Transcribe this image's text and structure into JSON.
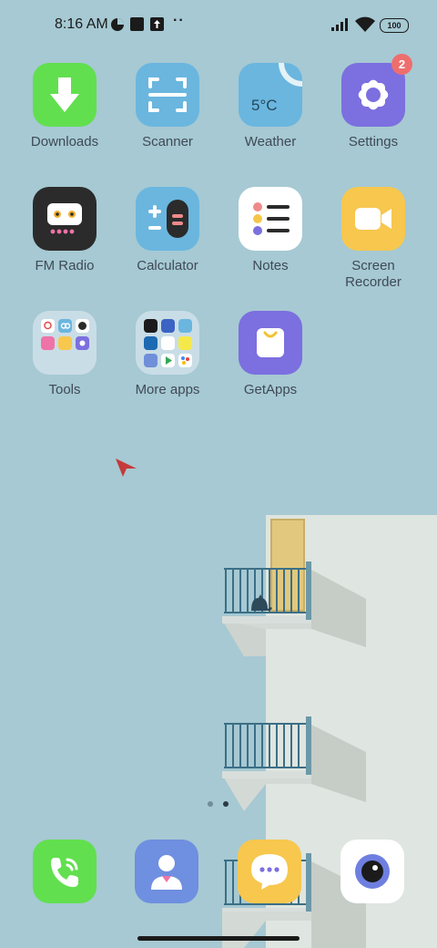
{
  "status_bar": {
    "time": "8:16 AM",
    "battery_text": "100",
    "more_indicator": "··",
    "icons": [
      "data-saver-icon",
      "square-notification-icon",
      "upload-notification-icon",
      "signal-icon",
      "wifi-icon",
      "battery-icon"
    ]
  },
  "apps": [
    {
      "label": "Downloads"
    },
    {
      "label": "Scanner"
    },
    {
      "label": "Weather",
      "temperature": "5°C"
    },
    {
      "label": "Settings",
      "badge": "2"
    },
    {
      "label": "FM Radio"
    },
    {
      "label": "Calculator"
    },
    {
      "label": "Notes"
    },
    {
      "label": "Screen\nRecorder"
    },
    {
      "label": "Tools"
    },
    {
      "label": "More apps"
    },
    {
      "label": "GetApps"
    }
  ],
  "dock": [
    {
      "name": "phone"
    },
    {
      "name": "contacts"
    },
    {
      "name": "messaging"
    },
    {
      "name": "camera"
    }
  ],
  "page_indicator": {
    "pages": 2,
    "current": 2
  },
  "colors": {
    "wallpaper": "#a6c9d3",
    "label": "#3f4a55",
    "badge": "#ee6e6e"
  }
}
